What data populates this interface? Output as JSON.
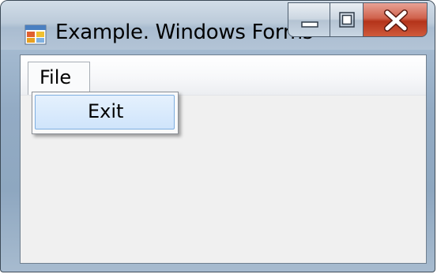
{
  "window": {
    "title": "Example. Windows Forms"
  },
  "caption_buttons": {
    "minimize_icon": "minimize-icon",
    "maximize_icon": "maximize-icon",
    "close_icon": "close-icon",
    "close_color": "#c4452a"
  },
  "menubar": {
    "items": [
      {
        "label": "File"
      }
    ]
  },
  "dropdown": {
    "items": [
      {
        "label": "Exit",
        "highlighted": true
      }
    ],
    "highlight_color": "#cfe4fb"
  }
}
